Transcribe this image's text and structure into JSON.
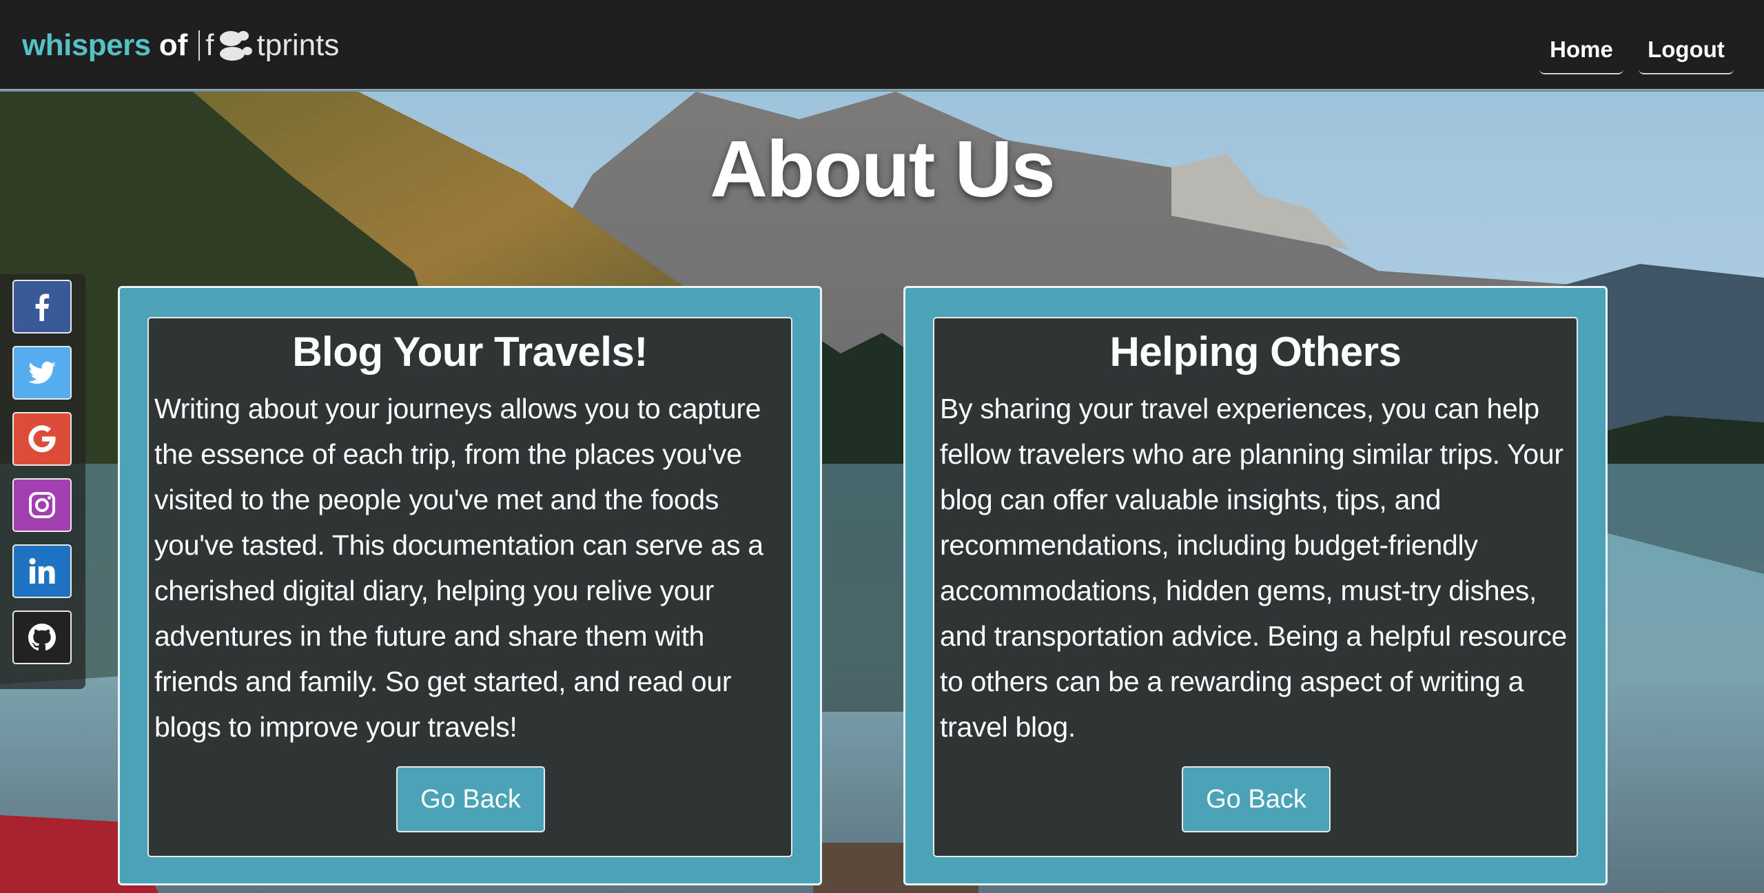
{
  "brand": {
    "whispers": "whispers",
    "of": "of",
    "foot_prefix": "f",
    "foot_suffix": "tprints",
    "logo_icon": "footprint-icon"
  },
  "nav": {
    "home_label": "Home",
    "logout_label": "Logout"
  },
  "page": {
    "title": "About Us"
  },
  "social": [
    {
      "name": "facebook",
      "icon": "facebook-icon",
      "color": "#3b5998"
    },
    {
      "name": "twitter",
      "icon": "twitter-icon",
      "color": "#55acee"
    },
    {
      "name": "google",
      "icon": "google-icon",
      "color": "#dd4b39"
    },
    {
      "name": "instagram",
      "icon": "instagram-icon",
      "color": "#a23fb0"
    },
    {
      "name": "linkedin",
      "icon": "linkedin-icon",
      "color": "#1e74c0"
    },
    {
      "name": "github",
      "icon": "github-icon",
      "color": "#222222"
    }
  ],
  "cards": [
    {
      "title": "Blog Your Travels!",
      "body": "Writing about your journeys allows you to capture the essence of each trip, from the places you've visited to the people you've met and the foods you've tasted. This documentation can serve as a cherished digital diary, helping you relive your adventures in the future and share them with friends and family. So get started, and read our blogs to improve your travels!",
      "button_label": "Go Back"
    },
    {
      "title": "Helping Others",
      "body": "By sharing your travel experiences, you can help fellow travelers who are planning similar trips. Your blog can offer valuable insights, tips, and recommendations, including budget-friendly accommodations, hidden gems, must-try dishes, and transportation advice. Being a helpful resource to others can be a rewarding aspect of writing a travel blog.",
      "button_label": "Go Back"
    }
  ],
  "colors": {
    "brand_teal": "#56c1c4",
    "navbar_bg": "#1e1e1e",
    "card_accent": "#4aa3b6",
    "card_panel": "#2f3437"
  }
}
